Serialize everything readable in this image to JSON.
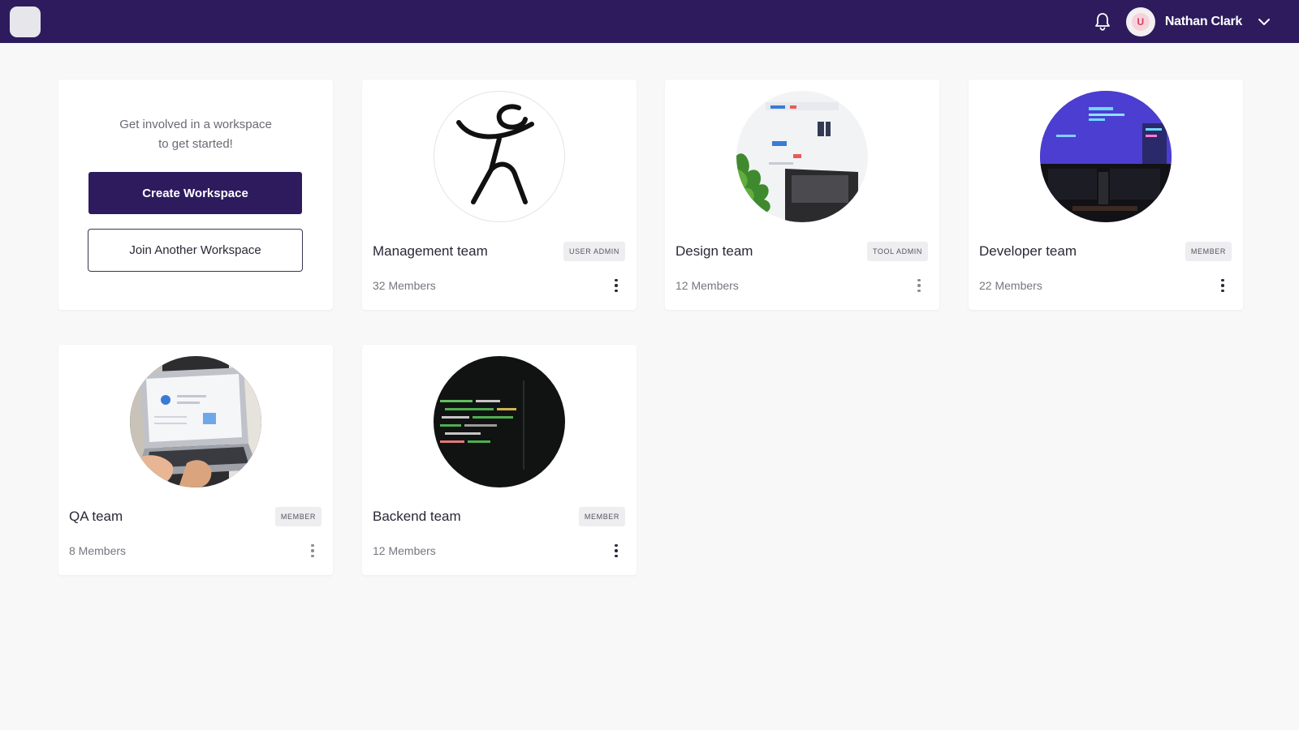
{
  "header": {
    "user_name": "Nathan Clark",
    "avatar_initial": "U",
    "brand_color": "#2d1b5e"
  },
  "intro": {
    "message_line1": "Get involved in a workspace",
    "message_line2": "to get started!",
    "create_label": "Create Workspace",
    "join_label": "Join Another Workspace"
  },
  "workspaces": [
    {
      "name": "Management team",
      "role": "USER ADMIN",
      "members": "32 Members",
      "image": "logo-figure"
    },
    {
      "name": "Design team",
      "role": "TOOL ADMIN",
      "members": "12 Members",
      "image": "desk-photo"
    },
    {
      "name": "Developer team",
      "role": "MEMBER",
      "members": "22 Members",
      "image": "monitors-photo"
    },
    {
      "name": "QA team",
      "role": "MEMBER",
      "members": "8 Members",
      "image": "laptop-photo"
    },
    {
      "name": "Backend team",
      "role": "MEMBER",
      "members": "12 Members",
      "image": "code-photo"
    }
  ]
}
